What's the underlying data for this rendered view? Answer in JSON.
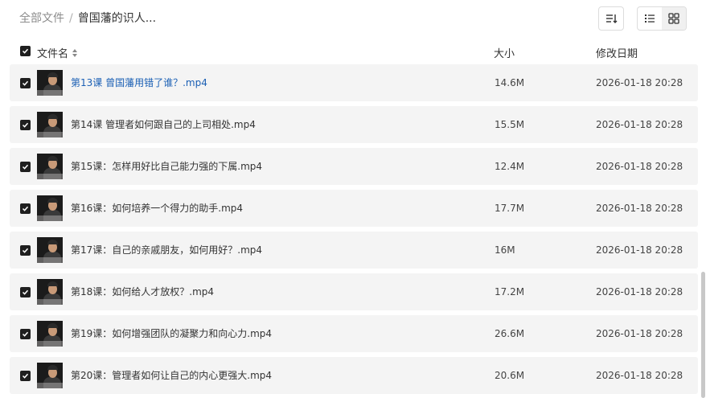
{
  "breadcrumb": {
    "root": "全部文件",
    "separator": "/",
    "current": "曾国藩的识人..."
  },
  "toolbar": {
    "sort_icon": "sort-descending-icon",
    "list_icon": "list-view-icon",
    "grid_icon": "grid-view-icon"
  },
  "columns": {
    "name": "文件名",
    "size": "大小",
    "modified": "修改日期"
  },
  "files": [
    {
      "name": "第13课 曾国藩用错了谁？.mp4",
      "size": "14.6M",
      "modified": "2026-01-18 20:28"
    },
    {
      "name": "第14课 管理者如何跟自己的上司相处.mp4",
      "size": "15.5M",
      "modified": "2026-01-18 20:28"
    },
    {
      "name": "第15课：怎样用好比自己能力强的下属.mp4",
      "size": "12.4M",
      "modified": "2026-01-18 20:28"
    },
    {
      "name": "第16课：如何培养一个得力的助手.mp4",
      "size": "17.7M",
      "modified": "2026-01-18 20:28"
    },
    {
      "name": "第17课：自己的亲戚朋友，如何用好？.mp4",
      "size": "16M",
      "modified": "2026-01-18 20:28"
    },
    {
      "name": "第18课：如何给人才放权？.mp4",
      "size": "17.2M",
      "modified": "2026-01-18 20:28"
    },
    {
      "name": "第19课：如何增强团队的凝聚力和向心力.mp4",
      "size": "26.6M",
      "modified": "2026-01-18 20:28"
    },
    {
      "name": "第20课：管理者如何让自己的内心更强大.mp4",
      "size": "20.6M",
      "modified": "2026-01-18 20:28"
    }
  ]
}
